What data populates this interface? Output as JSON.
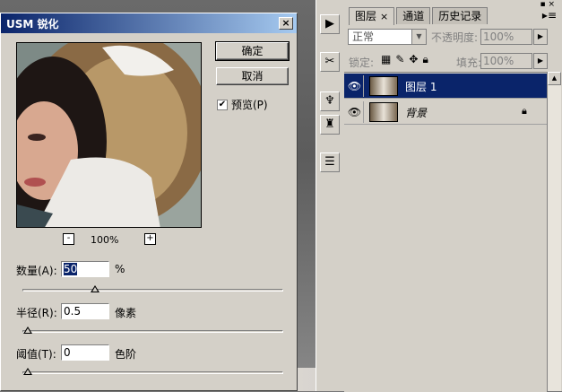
{
  "dialog": {
    "title": "USM 锐化",
    "close_glyph": "×",
    "ok_label": "确定",
    "cancel_label": "取消",
    "preview_label": "预览(P)",
    "preview_checked": true,
    "zoom_minus": "-",
    "zoom_plus": "+",
    "zoom_level": "100%",
    "amount": {
      "label": "数量(A):",
      "value": "50",
      "unit": "%",
      "slider_fraction": 0.27
    },
    "radius": {
      "label": "半径(R):",
      "value": "0.5",
      "unit": "像素",
      "slider_fraction": 0.0
    },
    "threshold": {
      "label": "阈值(T):",
      "value": "0",
      "unit": "色阶",
      "slider_fraction": 0.0
    }
  },
  "panel": {
    "tabs": [
      {
        "label": "图层",
        "close": "×"
      },
      {
        "label": "通道"
      },
      {
        "label": "历史记录"
      }
    ],
    "blend_mode": "正常",
    "opacity_label": "不透明度:",
    "opacity_value": "100%",
    "lock_label": "锁定:",
    "fill_label": "填充:",
    "fill_value": "100%",
    "layers": [
      {
        "name": "图层 1",
        "selected": true,
        "locked": false
      },
      {
        "name": "背景",
        "selected": false,
        "locked": true
      }
    ]
  },
  "icons": {
    "eye": "eye-icon",
    "lock": "lock-icon",
    "panel_menu": "menu-icon"
  }
}
